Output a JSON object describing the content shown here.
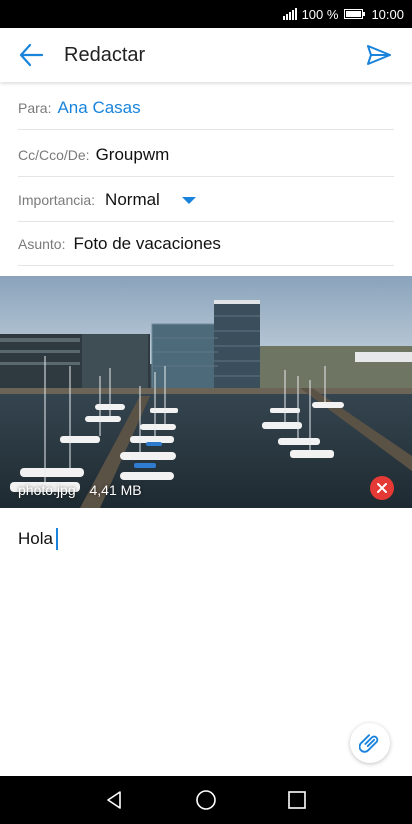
{
  "status_bar": {
    "battery_percent": "100 %",
    "time": "10:00",
    "signal_icon": "signal-icon",
    "battery_icon": "battery-icon"
  },
  "app_bar": {
    "title": "Redactar",
    "back_icon": "arrow-left-icon",
    "send_icon": "send-icon"
  },
  "fields": {
    "to": {
      "label": "Para:",
      "value": "Ana Casas"
    },
    "cc": {
      "label": "Cc/Cco/De:",
      "value": "Groupwm"
    },
    "importance": {
      "label": "Importancia:",
      "value": "Normal"
    },
    "subject": {
      "label": "Asunto:",
      "value": "Foto de vacaciones"
    }
  },
  "attachment": {
    "filename": "photo.jpg",
    "size": "4,41 MB",
    "remove_icon": "close-circle-icon"
  },
  "body": {
    "text": "Hola"
  },
  "nav_bar": {
    "back_icon": "triangle-back-icon",
    "home_icon": "circle-home-icon",
    "recents_icon": "square-recents-icon"
  },
  "colors": {
    "accent": "#1a84dc",
    "remove": "#e53935",
    "status_bar": "#000000"
  }
}
